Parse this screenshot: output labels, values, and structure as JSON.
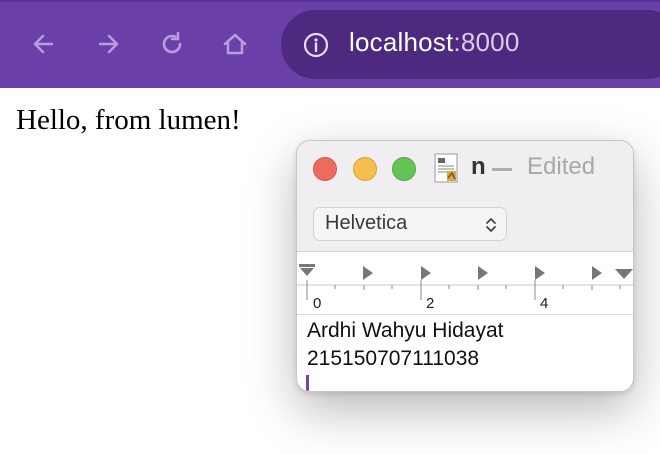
{
  "browser": {
    "url_host": "localhost",
    "url_port": ":8000",
    "accent_color": "#6a3fa7",
    "icons": [
      "back-icon",
      "forward-icon",
      "reload-icon",
      "home-icon",
      "info-icon"
    ]
  },
  "page": {
    "text": "Hello, from lumen!"
  },
  "textedit": {
    "title": "n",
    "status": "Edited",
    "font": "Helvetica",
    "ruler_labels": [
      "0",
      "2",
      "4"
    ],
    "lines": [
      "Ardhi Wahyu Hidayat",
      "215150707111038"
    ]
  }
}
